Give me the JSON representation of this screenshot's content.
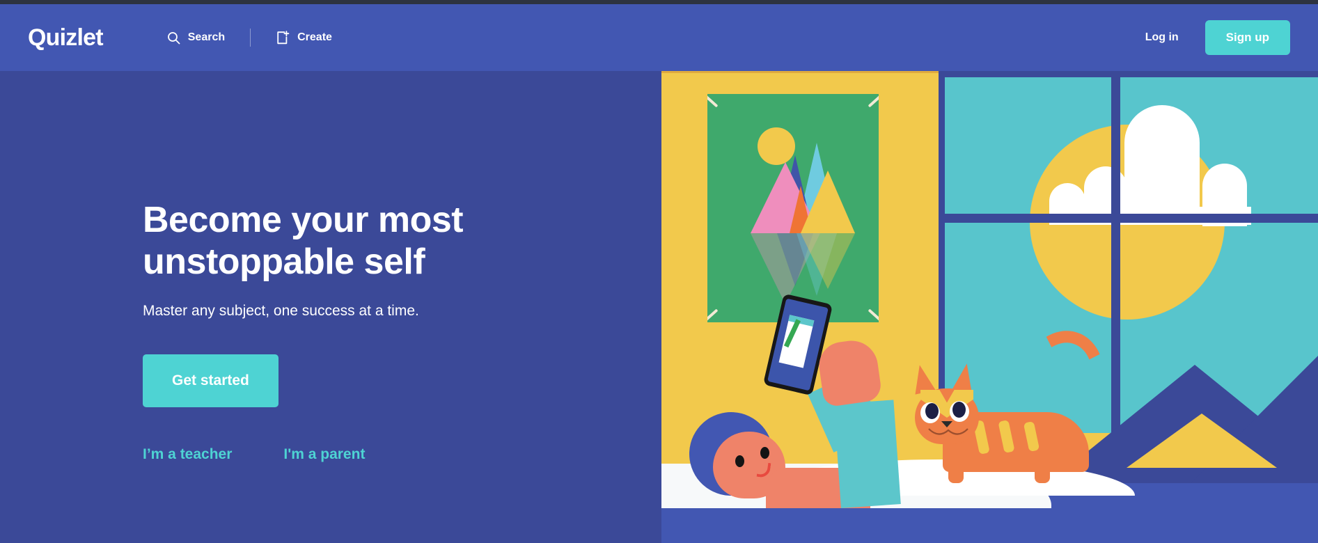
{
  "header": {
    "logo": "Quizlet",
    "nav": [
      {
        "label": "Search",
        "icon": "search-icon"
      },
      {
        "label": "Create",
        "icon": "create-icon"
      }
    ],
    "login_label": "Log in",
    "signup_label": "Sign up",
    "background_color": "#4257b2",
    "accent_color": "#4ed3d3"
  },
  "hero": {
    "title": "Become your most unstoppable self",
    "subtitle": "Master any subject, one success at a time.",
    "cta_label": "Get started",
    "links": [
      {
        "label": "I’m a teacher"
      },
      {
        "label": "I'm a parent"
      }
    ],
    "background_color": "#3b4998",
    "link_color": "#4ed3d3"
  },
  "illustration": {
    "name": "person-in-bed-with-phone-and-cat",
    "wall_color": "#f2c94c",
    "poster_color": "#3fa96c",
    "sky_color": "#58c5cc",
    "sun_color": "#f2c94c",
    "cloud_color": "#ffffff",
    "cat_color": "#ef7f47",
    "skin_color": "#ef8369",
    "hair_color": "#4257b2",
    "sleeve_color": "#5cc6cb",
    "blanket_color": "#3b4998",
    "floor_color": "#4257b2"
  }
}
